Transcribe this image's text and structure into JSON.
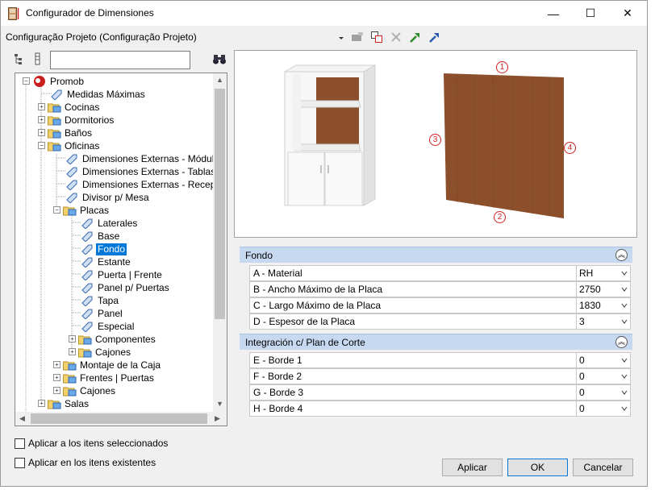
{
  "window": {
    "title": "Configurador de Dimensiones",
    "minimize": "—",
    "maximize": "☐",
    "close": "✕"
  },
  "config": {
    "label": "Configuração Projeto (Configuração Projeto)"
  },
  "tree": {
    "root": "Promob",
    "items": [
      "Medidas Máximas",
      "Cocinas",
      "Dormitorios",
      "Baños",
      "Oficinas",
      "Dimensiones Externas - Módulos",
      "Dimensiones Externas - Tablas",
      "Dimensiones Externas - Recepción",
      "Divisor p/ Mesa",
      "Placas",
      "Laterales",
      "Base",
      "Fondo",
      "Estante",
      "Puerta | Frente",
      "Panel p/ Puertas",
      "Tapa",
      "Panel",
      "Especial",
      "Componentes",
      "Cajones",
      "Montaje de la Caja",
      "Frentes | Puertas",
      "Cajones",
      "Salas"
    ]
  },
  "preview": {
    "markers": [
      "1",
      "2",
      "3",
      "4"
    ]
  },
  "groups": {
    "fondo": {
      "title": "Fondo",
      "rows": [
        {
          "name": "A - Material",
          "value": "RH"
        },
        {
          "name": "B -  Ancho Máximo de la Placa",
          "value": "2750"
        },
        {
          "name": "C - Largo Máximo de la Placa",
          "value": "1830"
        },
        {
          "name": "D - Espesor de la Placa",
          "value": "3"
        }
      ]
    },
    "integracion": {
      "title": "Integración c/ Plan de Corte",
      "rows": [
        {
          "name": "E - Borde 1",
          "value": "0"
        },
        {
          "name": "F - Borde 2",
          "value": "0"
        },
        {
          "name": "G - Borde 3",
          "value": "0"
        },
        {
          "name": "H - Borde 4",
          "value": "0"
        }
      ]
    }
  },
  "options": {
    "apply_selected": "Aplicar a los itens seleccionados",
    "apply_existing": "Aplicar en los itens existentes"
  },
  "buttons": {
    "apply": "Aplicar",
    "ok": "OK",
    "cancel": "Cancelar"
  },
  "colors": {
    "accent": "#0078d7",
    "group_header": "#c6d9f1",
    "wood": "#8b4f2c"
  }
}
